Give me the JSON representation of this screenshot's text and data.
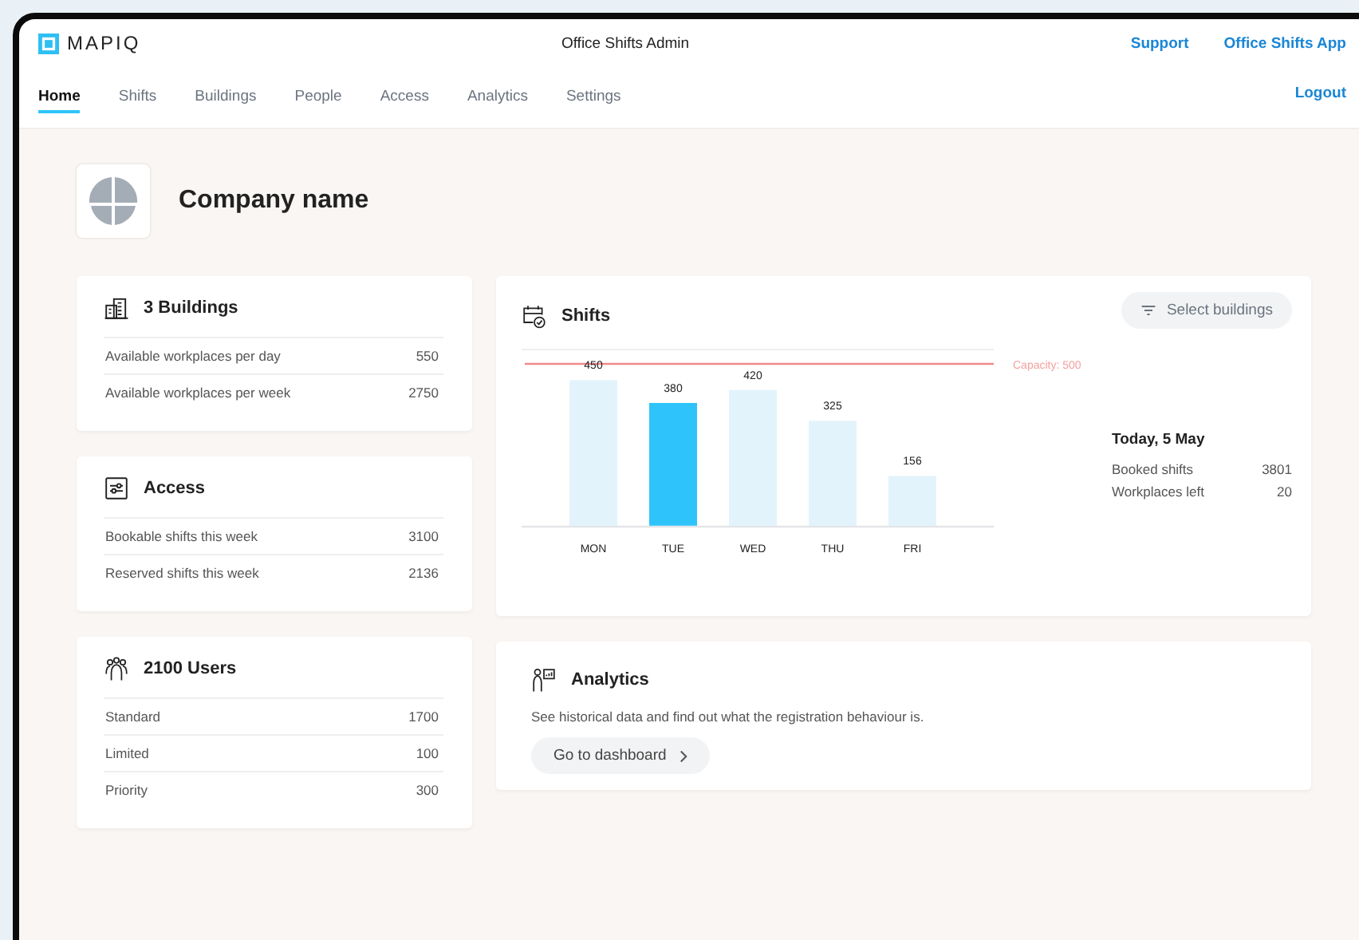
{
  "app": {
    "logo_text": "MAPIQ",
    "title": "Office Shifts Admin",
    "links": [
      "Support",
      "Office Shifts App"
    ]
  },
  "nav": {
    "tabs": [
      {
        "label": "Home",
        "selected": true
      },
      {
        "label": "Shifts",
        "selected": false
      },
      {
        "label": "Buildings",
        "selected": false
      },
      {
        "label": "People",
        "selected": false
      },
      {
        "label": "Access",
        "selected": false
      },
      {
        "label": "Analytics",
        "selected": false
      },
      {
        "label": "Settings",
        "selected": false
      }
    ],
    "logout": "Logout"
  },
  "company": {
    "name": "Company name"
  },
  "stat_cards": [
    {
      "kind": "buildings",
      "title": "3 Buildings",
      "rows": [
        {
          "label": "Available workplaces per day",
          "value": "550"
        },
        {
          "label": "Available workplaces per week",
          "value": "2750"
        }
      ]
    },
    {
      "kind": "access",
      "title": "Access",
      "rows": [
        {
          "label": "Bookable shifts this week",
          "value": "3100"
        },
        {
          "label": "Reserved shifts this week",
          "value": "2136"
        }
      ]
    },
    {
      "kind": "users",
      "title": "2100 Users",
      "rows": [
        {
          "label": "Standard",
          "value": "1700"
        },
        {
          "label": "Limited",
          "value": "100"
        },
        {
          "label": "Priority",
          "value": "300"
        }
      ]
    }
  ],
  "shifts": {
    "title": "Shifts",
    "filter_button": "Select buildings",
    "bar_selected": [
      false,
      true,
      false,
      false,
      false
    ],
    "chart_data": {
      "type": "bar",
      "categories": [
        "MON",
        "TUE",
        "WED",
        "THU",
        "FRI"
      ],
      "series": [
        {
          "values": [
            450,
            380,
            420,
            325,
            156
          ]
        }
      ],
      "data_labels": true
    },
    "capacity_label": "Capacity: 500",
    "summary": {
      "title": "Today, 5 May",
      "rows": [
        {
          "label": "Booked shifts",
          "value": "3801"
        },
        {
          "label": "Workplaces left",
          "value": "20"
        }
      ]
    }
  },
  "analytics": {
    "title": "Analytics",
    "description": "See historical data and find out what the registration behaviour is.",
    "button": "Go to dashboard"
  }
}
